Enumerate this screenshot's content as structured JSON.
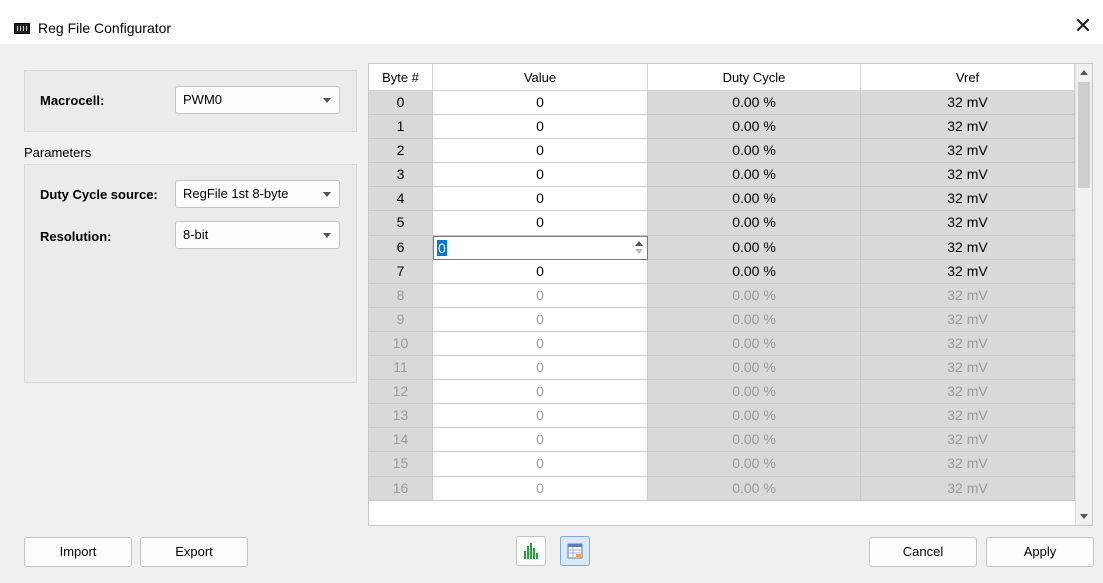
{
  "window": {
    "title": "Reg File Configurator",
    "close_glyph": "✕"
  },
  "macrocell": {
    "label": "Macrocell:",
    "value": "PWM0"
  },
  "parameters": {
    "section_label": "Parameters",
    "duty_source_label": "Duty Cycle source:",
    "duty_source_value": "RegFile 1st 8-byte",
    "resolution_label": "Resolution:",
    "resolution_value": "8-bit"
  },
  "table": {
    "headers": [
      "Byte #",
      "Value",
      "Duty Cycle",
      "Vref"
    ],
    "rows": [
      {
        "byte": "0",
        "value": "0",
        "duty": "0.00 %",
        "vref": "32 mV",
        "dim": false
      },
      {
        "byte": "1",
        "value": "0",
        "duty": "0.00 %",
        "vref": "32 mV",
        "dim": false
      },
      {
        "byte": "2",
        "value": "0",
        "duty": "0.00 %",
        "vref": "32 mV",
        "dim": false
      },
      {
        "byte": "3",
        "value": "0",
        "duty": "0.00 %",
        "vref": "32 mV",
        "dim": false
      },
      {
        "byte": "4",
        "value": "0",
        "duty": "0.00 %",
        "vref": "32 mV",
        "dim": false
      },
      {
        "byte": "5",
        "value": "0",
        "duty": "0.00 %",
        "vref": "32 mV",
        "dim": false
      },
      {
        "byte": "6",
        "value": "0",
        "duty": "0.00 %",
        "vref": "32 mV",
        "dim": false,
        "editing": true
      },
      {
        "byte": "7",
        "value": "0",
        "duty": "0.00 %",
        "vref": "32 mV",
        "dim": false
      },
      {
        "byte": "8",
        "value": "0",
        "duty": "0.00 %",
        "vref": "32 mV",
        "dim": true
      },
      {
        "byte": "9",
        "value": "0",
        "duty": "0.00 %",
        "vref": "32 mV",
        "dim": true
      },
      {
        "byte": "10",
        "value": "0",
        "duty": "0.00 %",
        "vref": "32 mV",
        "dim": true
      },
      {
        "byte": "11",
        "value": "0",
        "duty": "0.00 %",
        "vref": "32 mV",
        "dim": true
      },
      {
        "byte": "12",
        "value": "0",
        "duty": "0.00 %",
        "vref": "32 mV",
        "dim": true
      },
      {
        "byte": "13",
        "value": "0",
        "duty": "0.00 %",
        "vref": "32 mV",
        "dim": true
      },
      {
        "byte": "14",
        "value": "0",
        "duty": "0.00 %",
        "vref": "32 mV",
        "dim": true
      },
      {
        "byte": "15",
        "value": "0",
        "duty": "0.00 %",
        "vref": "32 mV",
        "dim": true
      },
      {
        "byte": "16",
        "value": "0",
        "duty": "0.00 %",
        "vref": "32 mV",
        "dim": true
      }
    ]
  },
  "buttons": {
    "import": "Import",
    "export": "Export",
    "cancel": "Cancel",
    "apply": "Apply"
  },
  "icons": {
    "chart_view": "bar-chart-icon",
    "table_view": "table-view-icon"
  },
  "colors": {
    "chart_icon": "#22a33a",
    "selection": "#0078d7"
  }
}
